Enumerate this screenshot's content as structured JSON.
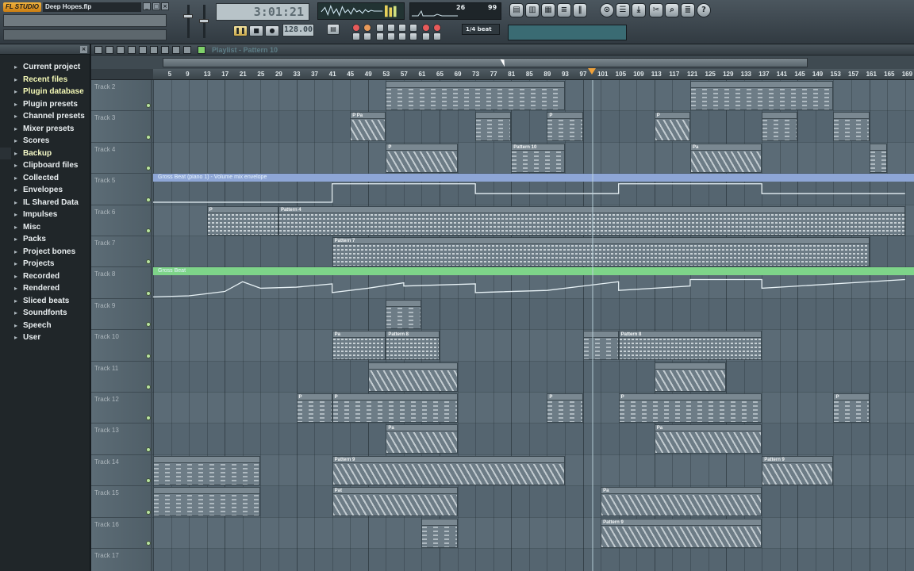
{
  "window": {
    "app_logo": "FL STUDIO",
    "song_title": "Deep Hopes.flp"
  },
  "transport": {
    "time": "3:01:21",
    "tempo": "128.00",
    "cpu_value": "26",
    "poly_value": "99",
    "snap": "1/4 beat"
  },
  "browser": {
    "items": [
      {
        "label": "Current project",
        "icon": "folder-icon",
        "style": "normal"
      },
      {
        "label": "Recent files",
        "icon": "folder-icon",
        "style": "hi"
      },
      {
        "label": "Plugin database",
        "icon": "folder-icon",
        "style": "hi"
      },
      {
        "label": "Plugin presets",
        "icon": "folder-icon",
        "style": "normal"
      },
      {
        "label": "Channel presets",
        "icon": "folder-icon",
        "style": "normal"
      },
      {
        "label": "Mixer presets",
        "icon": "folder-icon",
        "style": "normal"
      },
      {
        "label": "Scores",
        "icon": "folder-icon",
        "style": "normal"
      },
      {
        "label": "Backup",
        "icon": "folder-icon",
        "style": "hi2"
      },
      {
        "label": "Clipboard files",
        "icon": "folder-icon",
        "style": "normal"
      },
      {
        "label": "Collected",
        "icon": "folder-icon",
        "style": "normal"
      },
      {
        "label": "Envelopes",
        "icon": "folder-icon",
        "style": "normal"
      },
      {
        "label": "IL Shared Data",
        "icon": "folder-icon",
        "style": "normal"
      },
      {
        "label": "Impulses",
        "icon": "folder-icon",
        "style": "normal"
      },
      {
        "label": "Misc",
        "icon": "folder-icon",
        "style": "normal"
      },
      {
        "label": "Packs",
        "icon": "folder-icon",
        "style": "normal"
      },
      {
        "label": "Project bones",
        "icon": "folder-icon",
        "style": "normal"
      },
      {
        "label": "Projects",
        "icon": "folder-icon",
        "style": "normal"
      },
      {
        "label": "Recorded",
        "icon": "folder-icon",
        "style": "normal"
      },
      {
        "label": "Rendered",
        "icon": "folder-icon",
        "style": "normal"
      },
      {
        "label": "Sliced beats",
        "icon": "folder-icon",
        "style": "normal"
      },
      {
        "label": "Soundfonts",
        "icon": "folder-icon",
        "style": "normal"
      },
      {
        "label": "Speech",
        "icon": "folder-icon",
        "style": "normal"
      },
      {
        "label": "User",
        "icon": "folder-icon",
        "style": "normal"
      }
    ]
  },
  "playlist": {
    "title": "Playlist - Pattern 10",
    "bar_numbers": [
      "5",
      "9",
      "13",
      "17",
      "21",
      "25",
      "29",
      "33",
      "37",
      "41",
      "45",
      "49",
      "53",
      "57",
      "61",
      "65",
      "69",
      "73",
      "77",
      "81",
      "85",
      "89",
      "93",
      "97",
      "101",
      "105",
      "109",
      "113",
      "117",
      "121",
      "125",
      "129",
      "133",
      "137",
      "141",
      "145",
      "149",
      "153",
      "157",
      "161",
      "165",
      "169"
    ],
    "tracks": [
      "Track 2",
      "Track 3",
      "Track 4",
      "Track 5",
      "Track 6",
      "Track 7",
      "Track 8",
      "Track 9",
      "Track 10",
      "Track 11",
      "Track 12",
      "Track 13",
      "Track 14",
      "Track 15",
      "Track 16",
      "Track 17"
    ],
    "envelope_labels": {
      "track5": "Gross Beat (piano 1) - Volume mix envelope",
      "track8": "Gross Beat"
    },
    "clips": [
      {
        "track": 0,
        "start": 53,
        "end": 93,
        "label": "",
        "style": "sparse"
      },
      {
        "track": 0,
        "start": 121,
        "end": 153,
        "label": "",
        "style": "sparse"
      },
      {
        "track": 1,
        "start": 45,
        "end": 53,
        "label": "P Pa",
        "style": "diag"
      },
      {
        "track": 1,
        "start": 73,
        "end": 81,
        "label": "",
        "style": "sparse"
      },
      {
        "track": 1,
        "start": 89,
        "end": 97,
        "label": "P",
        "style": "sparse"
      },
      {
        "track": 1,
        "start": 113,
        "end": 121,
        "label": "P",
        "style": "diag"
      },
      {
        "track": 1,
        "start": 137,
        "end": 145,
        "label": "",
        "style": "sparse"
      },
      {
        "track": 1,
        "start": 153,
        "end": 161,
        "label": "",
        "style": "sparse"
      },
      {
        "track": 2,
        "start": 53,
        "end": 69,
        "label": "P",
        "style": "diag"
      },
      {
        "track": 2,
        "start": 81,
        "end": 93,
        "label": "Pattern 10",
        "style": "sparse"
      },
      {
        "track": 2,
        "start": 121,
        "end": 137,
        "label": "Pa",
        "style": "diag"
      },
      {
        "track": 2,
        "start": 161,
        "end": 165,
        "label": "",
        "style": "sparse"
      },
      {
        "track": 4,
        "start": 13,
        "end": 29,
        "label": "P",
        "style": "dense"
      },
      {
        "track": 4,
        "start": 29,
        "end": 169,
        "label": "Pattern 4",
        "style": "dense"
      },
      {
        "track": 5,
        "start": 41,
        "end": 161,
        "label": "Pattern 7",
        "style": "dense"
      },
      {
        "track": 7,
        "start": 53,
        "end": 61,
        "label": "",
        "style": "sparse"
      },
      {
        "track": 8,
        "start": 41,
        "end": 53,
        "label": "Pa",
        "style": "dense"
      },
      {
        "track": 8,
        "start": 53,
        "end": 65,
        "label": "Pattern 8",
        "style": "dense"
      },
      {
        "track": 8,
        "start": 97,
        "end": 105,
        "label": "",
        "style": "sparse"
      },
      {
        "track": 8,
        "start": 105,
        "end": 137,
        "label": "Pattern 8",
        "style": "dense"
      },
      {
        "track": 9,
        "start": 49,
        "end": 69,
        "label": "",
        "style": "diag"
      },
      {
        "track": 9,
        "start": 113,
        "end": 129,
        "label": "",
        "style": "diag"
      },
      {
        "track": 10,
        "start": 33,
        "end": 41,
        "label": "P",
        "style": "sparse"
      },
      {
        "track": 10,
        "start": 41,
        "end": 69,
        "label": "P",
        "style": "sparse"
      },
      {
        "track": 10,
        "start": 89,
        "end": 97,
        "label": "P",
        "style": "sparse"
      },
      {
        "track": 10,
        "start": 105,
        "end": 137,
        "label": "P",
        "style": "sparse"
      },
      {
        "track": 10,
        "start": 153,
        "end": 161,
        "label": "P",
        "style": "sparse"
      },
      {
        "track": 11,
        "start": 53,
        "end": 69,
        "label": "Pa",
        "style": "diag"
      },
      {
        "track": 11,
        "start": 113,
        "end": 137,
        "label": "Pa",
        "style": "diag"
      },
      {
        "track": 12,
        "start": 1,
        "end": 25,
        "label": "",
        "style": "sparse"
      },
      {
        "track": 12,
        "start": 41,
        "end": 93,
        "label": "Pattern 9",
        "style": "diag"
      },
      {
        "track": 12,
        "start": 137,
        "end": 153,
        "label": "Pattern 9",
        "style": "diag"
      },
      {
        "track": 13,
        "start": 1,
        "end": 25,
        "label": "",
        "style": "sparse"
      },
      {
        "track": 13,
        "start": 41,
        "end": 69,
        "label": "Pat",
        "style": "diag"
      },
      {
        "track": 13,
        "start": 101,
        "end": 137,
        "label": "Pa",
        "style": "diag"
      },
      {
        "track": 14,
        "start": 61,
        "end": 69,
        "label": "",
        "style": "sparse"
      },
      {
        "track": 14,
        "start": 101,
        "end": 137,
        "label": "Pattern 9",
        "style": "diag"
      }
    ],
    "playhead_bar": 99,
    "colors": {
      "clip": "#6d7c86",
      "env_blue": "#8ea6d6",
      "env_green": "#7ed489",
      "marker": "#f0a23a"
    }
  }
}
